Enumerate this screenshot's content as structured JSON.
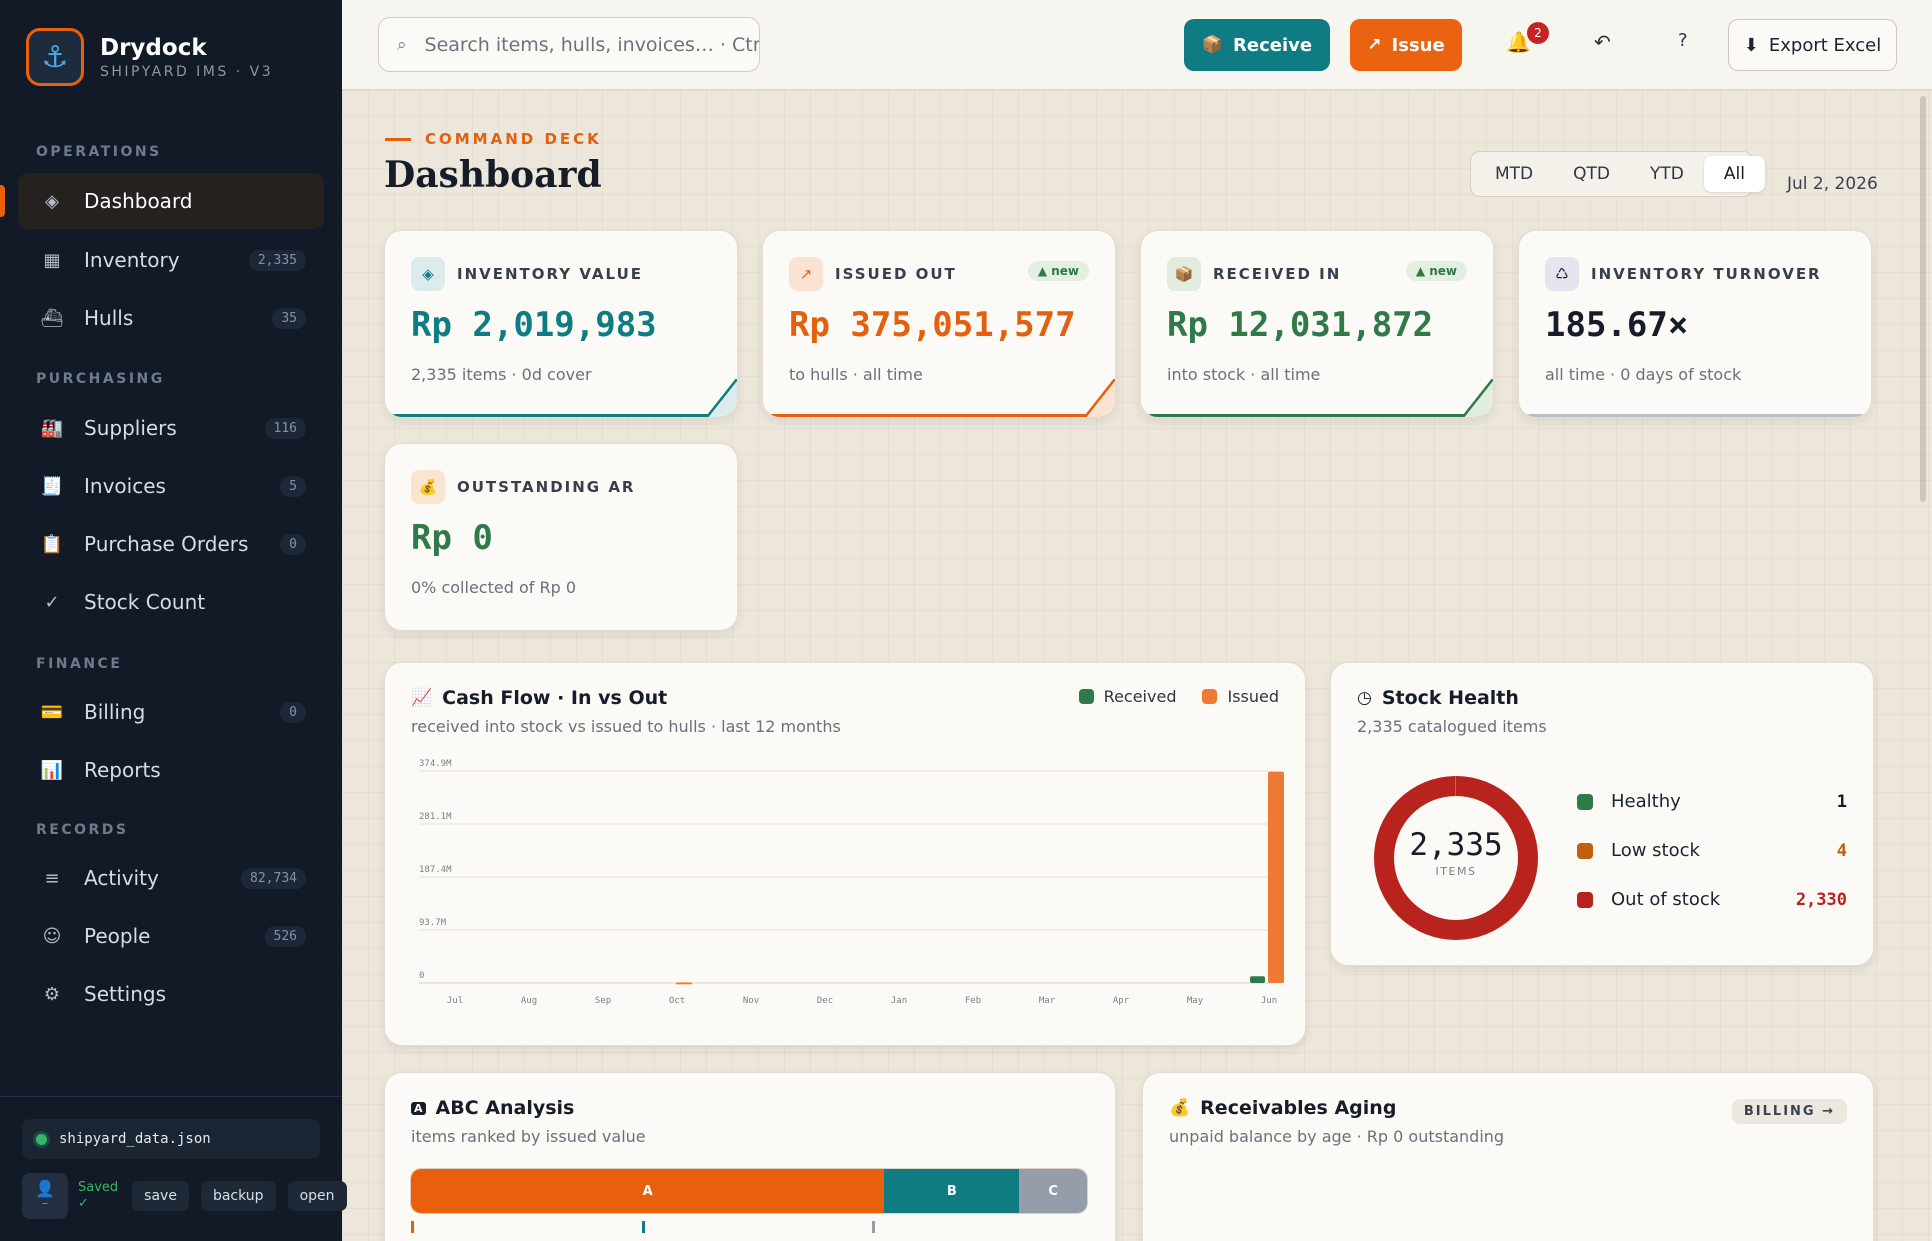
{
  "brand": {
    "name": "Drydock",
    "subtitle": "SHIPYARD IMS · V3"
  },
  "sidebar": {
    "sections": [
      {
        "label": "OPERATIONS",
        "items": [
          {
            "label": "Dashboard",
            "icon": "diamond-icon",
            "glyph": "◈",
            "badge": "",
            "active": true
          },
          {
            "label": "Inventory",
            "icon": "grid-icon",
            "glyph": "▦",
            "badge": "2,335"
          },
          {
            "label": "Hulls",
            "icon": "ship-icon",
            "glyph": "⛴",
            "badge": "35"
          }
        ]
      },
      {
        "label": "PURCHASING",
        "items": [
          {
            "label": "Suppliers",
            "icon": "factory-icon",
            "glyph": "🏭",
            "badge": "116"
          },
          {
            "label": "Invoices",
            "icon": "receipt-icon",
            "glyph": "🧾",
            "badge": "5"
          },
          {
            "label": "Purchase Orders",
            "icon": "clipboard-icon",
            "glyph": "📋",
            "badge": "0"
          },
          {
            "label": "Stock Count",
            "icon": "check-icon",
            "glyph": "✓",
            "badge": ""
          }
        ]
      },
      {
        "label": "FINANCE",
        "items": [
          {
            "label": "Billing",
            "icon": "credit-card-icon",
            "glyph": "💳",
            "badge": "0"
          },
          {
            "label": "Reports",
            "icon": "bar-chart-icon",
            "glyph": "📊",
            "badge": ""
          }
        ]
      },
      {
        "label": "RECORDS",
        "items": [
          {
            "label": "Activity",
            "icon": "list-icon",
            "glyph": "≡",
            "badge": "82,734"
          },
          {
            "label": "People",
            "icon": "smiley-icon",
            "glyph": "☺",
            "badge": "526"
          },
          {
            "label": "Settings",
            "icon": "gear-icon",
            "glyph": "⚙",
            "badge": ""
          }
        ]
      }
    ],
    "footer": {
      "filename": "shipyard_data.json",
      "avatar_dash": "–",
      "saved": "Saved",
      "saved_check": "✓",
      "buttons": [
        "save",
        "backup",
        "open"
      ]
    }
  },
  "topbar": {
    "search_placeholder": "Search items, hulls, invoices…  ·  Ctrl",
    "receive": "Receive",
    "issue": "Issue",
    "notification_count": "2",
    "export": "Export Excel"
  },
  "header": {
    "eyebrow": "COMMAND DECK",
    "title": "Dashboard",
    "periods": [
      "MTD",
      "QTD",
      "YTD",
      "All"
    ],
    "active_period": "All",
    "date": "Jul 2, 2026"
  },
  "kpis": [
    {
      "label": "INVENTORY VALUE",
      "value": "Rp 2,019,983",
      "sub": "2,335 items · 0d cover",
      "badge": "",
      "color": "#0f7c83",
      "icon_bg": "#dcecec",
      "glyph": "◈",
      "icon": "diamond-icon"
    },
    {
      "label": "ISSUED OUT",
      "value": "Rp 375,051,577",
      "sub": "to hulls · all time",
      "badge": "▲ new",
      "color": "#e2600e",
      "icon_bg": "#fbe3d3",
      "glyph": "↗",
      "icon": "arrow-up-right-icon"
    },
    {
      "label": "RECEIVED IN",
      "value": "Rp 12,031,872",
      "sub": "into stock · all time",
      "badge": "▲ new",
      "color": "#2f7a48",
      "icon_bg": "#e2ecdf",
      "glyph": "📦",
      "icon": "package-icon"
    },
    {
      "label": "INVENTORY TURNOVER",
      "value": "185.67×",
      "sub": "all time · 0 days of stock",
      "badge": "",
      "color": "#161d28",
      "icon_bg": "#e6e4ef",
      "glyph": "♺",
      "icon": "recycle-icon"
    },
    {
      "label": "OUTSTANDING AR",
      "value": "Rp 0",
      "sub": "0% collected of Rp 0",
      "badge": "",
      "color": "#2f7a48",
      "icon_bg": "#f8e6d2",
      "glyph": "💰",
      "icon": "money-bag-icon"
    }
  ],
  "cashflow": {
    "title": "Cash Flow · In vs Out",
    "subtitle": "received into stock vs issued to hulls · last 12 months",
    "colors": {
      "received": "#2f7a48",
      "issued": "#ef7a34"
    }
  },
  "chart_data": {
    "type": "bar",
    "categories": [
      "Jul",
      "Aug",
      "Sep",
      "Oct",
      "Nov",
      "Dec",
      "Jan",
      "Feb",
      "Mar",
      "Apr",
      "May",
      "Jun"
    ],
    "series": [
      {
        "name": "Received",
        "values": [
          0,
          0,
          0,
          0,
          0,
          0,
          0,
          0,
          0,
          0,
          0,
          12031872
        ]
      },
      {
        "name": "Issued",
        "values": [
          0,
          0,
          0,
          1200000,
          0,
          0,
          0,
          0,
          0,
          0,
          0,
          373851577
        ]
      }
    ],
    "yticks": [
      "0",
      "93.7M",
      "187.4M",
      "281.1M",
      "374.9M"
    ],
    "ytick_values": [
      0,
      93700000,
      187400000,
      281100000,
      374900000
    ],
    "ylim": [
      0,
      374900000
    ],
    "grid": true,
    "legend": "top-right"
  },
  "stock_health": {
    "title": "Stock Health",
    "subtitle": "2,335 catalogued items",
    "total": "2,335",
    "total_label": "ITEMS",
    "rows": [
      {
        "label": "Healthy",
        "value": "1",
        "count": 1,
        "color": "#2f7a48",
        "value_color": "#161d28"
      },
      {
        "label": "Low stock",
        "value": "4",
        "count": 4,
        "color": "#c25e10",
        "value_color": "#c25e10"
      },
      {
        "label": "Out of stock",
        "value": "2,330",
        "count": 2330,
        "color": "#b8231e",
        "value_color": "#b8231e"
      }
    ]
  },
  "abc": {
    "title": "ABC Analysis",
    "subtitle": "items ranked by issued value",
    "segments": [
      {
        "label": "A",
        "share": 0.7,
        "color": "#e8600c"
      },
      {
        "label": "B",
        "share": 0.2,
        "color": "#0f7c83"
      },
      {
        "label": "C",
        "share": 0.1,
        "color": "#959dab"
      }
    ]
  },
  "aging": {
    "title": "Receivables Aging",
    "subtitle": "unpaid balance by age · Rp 0 outstanding",
    "link": "BILLING →"
  }
}
